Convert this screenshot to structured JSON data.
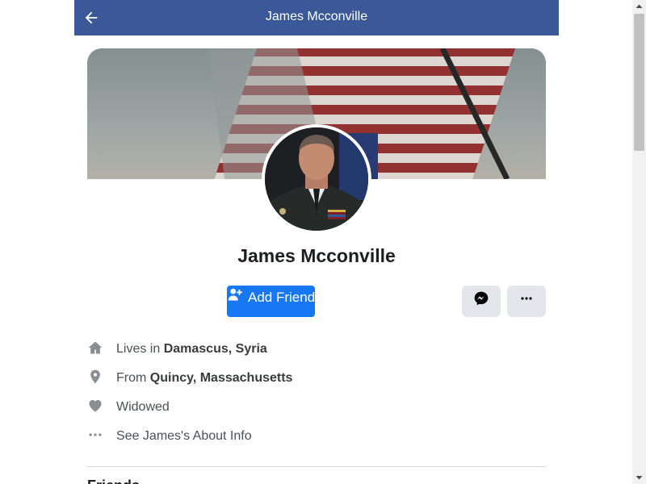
{
  "header": {
    "title": "James Mcconville",
    "back_icon": "arrow-left-icon",
    "background": "#3b5998"
  },
  "profile": {
    "name": "James Mcconville",
    "add_friend_label": "Add Friend",
    "add_friend_color": "#1877f2",
    "messenger_icon": "messenger-icon",
    "more_icon": "more-horizontal-icon"
  },
  "info": {
    "lives_prefix": "Lives in ",
    "lives_place": "Damascus, Syria",
    "from_prefix": "From ",
    "from_place": "Quincy, Massachusetts",
    "relationship": "Widowed",
    "about_link": "See James's About Info"
  },
  "sections": {
    "friends_heading": "Friends"
  }
}
